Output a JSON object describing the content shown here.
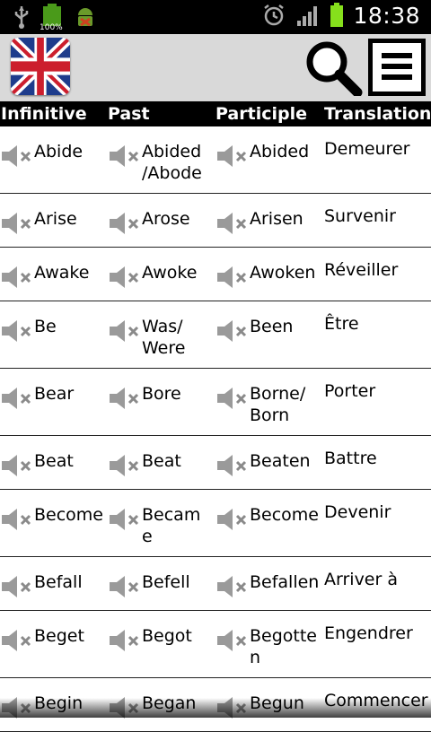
{
  "status_bar": {
    "time": "18:38",
    "battery_label": "100%",
    "icons": [
      "usb-icon",
      "battery-full-icon",
      "android-debug-icon",
      "alarm-icon",
      "signal-icon",
      "battery-icon"
    ]
  },
  "app_bar": {
    "flag_icon": "uk-flag-icon",
    "search_icon": "search-icon",
    "menu_icon": "menu-icon"
  },
  "columns": {
    "infinitive": "Infinitive",
    "past": "Past",
    "participle": "Participle",
    "translation": "Translation"
  },
  "colors": {
    "status_bg": "#000000",
    "appbar_bg": "#d9d9d9",
    "header_bg": "#000000",
    "row_bg": "#ffffff"
  },
  "verbs": [
    {
      "infinitive": [
        "Abide"
      ],
      "past": [
        "Abided",
        "/Abode"
      ],
      "participle": [
        "Abided"
      ],
      "translation": "Demeurer"
    },
    {
      "infinitive": [
        "Arise"
      ],
      "past": [
        "Arose"
      ],
      "participle": [
        "Arisen"
      ],
      "translation": "Survenir"
    },
    {
      "infinitive": [
        "Awake"
      ],
      "past": [
        "Awoke"
      ],
      "participle": [
        "Awoken"
      ],
      "translation": "Réveiller"
    },
    {
      "infinitive": [
        "Be"
      ],
      "past": [
        "Was/",
        "Were"
      ],
      "participle": [
        "Been"
      ],
      "translation": "Être"
    },
    {
      "infinitive": [
        "Bear"
      ],
      "past": [
        "Bore"
      ],
      "participle": [
        "Borne/",
        "Born"
      ],
      "translation": "Porter"
    },
    {
      "infinitive": [
        "Beat"
      ],
      "past": [
        "Beat"
      ],
      "participle": [
        "Beaten"
      ],
      "translation": "Battre"
    },
    {
      "infinitive": [
        "Become"
      ],
      "past": [
        "Becam",
        "e"
      ],
      "participle": [
        "Become"
      ],
      "translation": "Devenir"
    },
    {
      "infinitive": [
        "Befall"
      ],
      "past": [
        "Befell"
      ],
      "participle": [
        "Befallen"
      ],
      "translation": "Arriver à"
    },
    {
      "infinitive": [
        "Beget"
      ],
      "past": [
        "Begot"
      ],
      "participle": [
        "Begotte",
        "n"
      ],
      "translation": "Engendrer"
    },
    {
      "infinitive": [
        "Begin"
      ],
      "past": [
        "Began"
      ],
      "participle": [
        "Begun"
      ],
      "translation": "Commencer"
    }
  ]
}
